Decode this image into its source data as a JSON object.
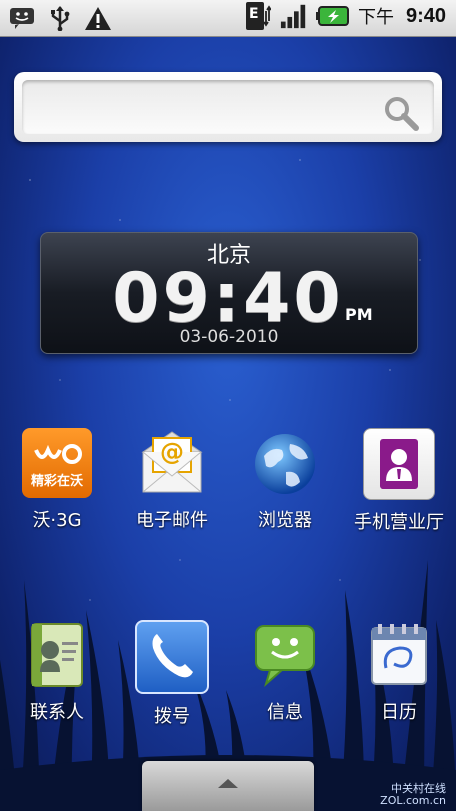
{
  "status_bar": {
    "ampm": "下午",
    "time": "9:40",
    "network_badge": "E",
    "left_icons": [
      "notification-smiley-icon",
      "usb-icon",
      "warning-icon"
    ],
    "right_icons": [
      "data-network-icon",
      "signal-bars-icon",
      "battery-charging-icon"
    ]
  },
  "search": {
    "icon": "search-icon"
  },
  "clock_widget": {
    "city": "北京",
    "time": "09:40",
    "ampm": "PM",
    "date": "03-06-2010"
  },
  "apps_row1": [
    {
      "label": "沃·3G",
      "icon_text": "精彩在沃",
      "icon": "wo-3g-icon"
    },
    {
      "label": "电子邮件",
      "icon_text": "@",
      "icon": "email-icon"
    },
    {
      "label": "浏览器",
      "icon": "browser-globe-icon"
    },
    {
      "label": "手机营业厅",
      "icon": "mobile-hall-icon"
    }
  ],
  "apps_row2": [
    {
      "label": "联系人",
      "icon": "contacts-icon"
    },
    {
      "label": "拨号",
      "icon": "phone-icon"
    },
    {
      "label": "信息",
      "icon": "messaging-icon"
    },
    {
      "label": "日历",
      "icon": "calendar-icon"
    }
  ],
  "drawer": {
    "icon": "chevron-up-icon"
  },
  "watermark": {
    "line1": "中关村在线",
    "line2": "ZOL.com.cn"
  },
  "colors": {
    "wallpaper": "#1b3fa8",
    "statusbar": "#e0e0e0",
    "battery": "#3bb53b"
  }
}
